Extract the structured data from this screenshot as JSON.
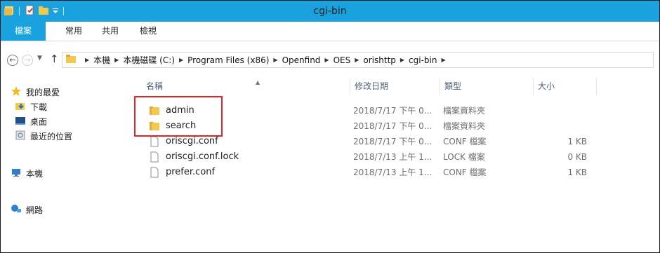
{
  "window": {
    "title": "cgi-bin"
  },
  "ribbon": {
    "tabs": [
      "檔案",
      "常用",
      "共用",
      "檢視"
    ]
  },
  "address": {
    "path": [
      "本機",
      "本機磁碟 (C:)",
      "Program Files (x86)",
      "Openfind",
      "OES",
      "orishttp",
      "cgi-bin"
    ]
  },
  "sidebar": {
    "items": [
      {
        "label": "我的最愛",
        "icon": "star-icon"
      },
      {
        "label": "下載",
        "icon": "downloads-icon"
      },
      {
        "label": "桌面",
        "icon": "desktop-icon"
      },
      {
        "label": "最近的位置",
        "icon": "recent-places-icon"
      },
      {
        "label": "本機",
        "icon": "computer-icon"
      },
      {
        "label": "網路",
        "icon": "network-icon"
      }
    ]
  },
  "columns": {
    "name": "名稱",
    "date": "修改日期",
    "type": "類型",
    "size": "大小"
  },
  "files": [
    {
      "name": "admin",
      "date": "2018/7/17 下午 0...",
      "type": "檔案資料夾",
      "size": "",
      "icon": "folder-icon"
    },
    {
      "name": "search",
      "date": "2018/7/17 下午 0...",
      "type": "檔案資料夾",
      "size": "",
      "icon": "folder-icon"
    },
    {
      "name": "oriscgi.conf",
      "date": "2018/7/17 下午 0...",
      "type": "CONF 檔案",
      "size": "1 KB",
      "icon": "file-icon"
    },
    {
      "name": "oriscgi.conf.lock",
      "date": "2018/7/13 上午 1...",
      "type": "LOCK 檔案",
      "size": "0 KB",
      "icon": "file-icon"
    },
    {
      "name": "prefer.conf",
      "date": "2018/7/13 上午 1...",
      "type": "CONF 檔案",
      "size": "1 KB",
      "icon": "file-icon"
    }
  ],
  "colors": {
    "accent": "#19a2de",
    "highlight": "#e0242b"
  }
}
